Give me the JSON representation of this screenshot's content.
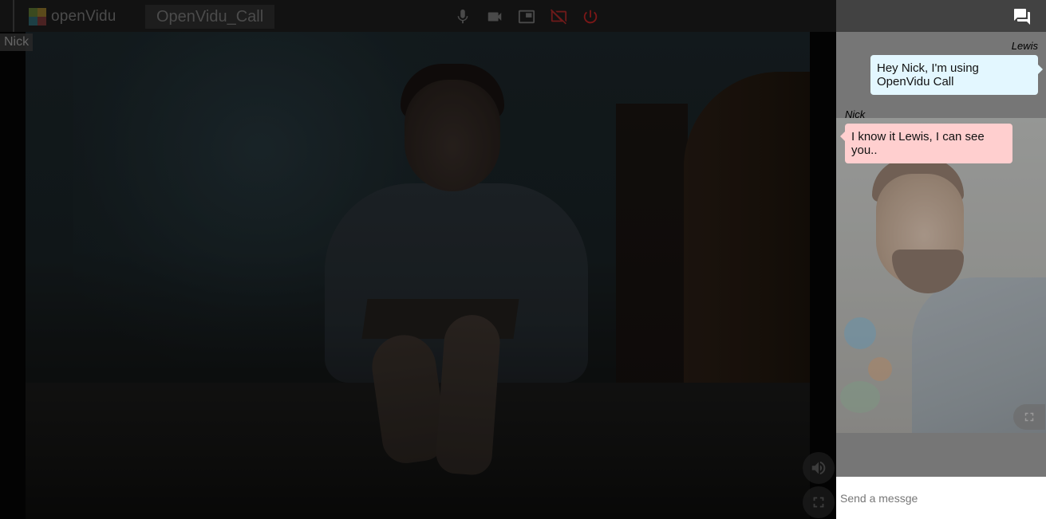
{
  "toolbar": {
    "logo_text": "openVidu",
    "session_title": "OpenVidu_Call",
    "controls": [
      {
        "icon": "mic-icon",
        "label": "microphone"
      },
      {
        "icon": "videocam-icon",
        "label": "camera"
      },
      {
        "icon": "screen-share-icon",
        "label": "screen share"
      },
      {
        "icon": "screen-share-off-icon",
        "label": "stop screen share"
      },
      {
        "icon": "power-icon",
        "label": "leave session"
      }
    ]
  },
  "main_video": {
    "nickname": "Nick",
    "volume_icon": "volume-up-icon",
    "fullscreen_icon": "fullscreen-icon"
  },
  "chat": {
    "toggle_icon": "chat-icon",
    "messages": [
      {
        "sender": "Lewis",
        "text": "Hey Nick, I'm using OpenVidu Call"
      },
      {
        "sender": "Nick",
        "text": "I know it Lewis, I can see you.."
      }
    ],
    "input_placeholder": "Send a messge"
  },
  "colors": {
    "lewis_bubble": "#e3f7ff",
    "nick_bubble": "#ffcfcf",
    "leave_button": "#7a1717",
    "screen_share_off": "#7a1717",
    "toolbar_bg": "#141414",
    "chat_panel_bg": "#767676"
  }
}
